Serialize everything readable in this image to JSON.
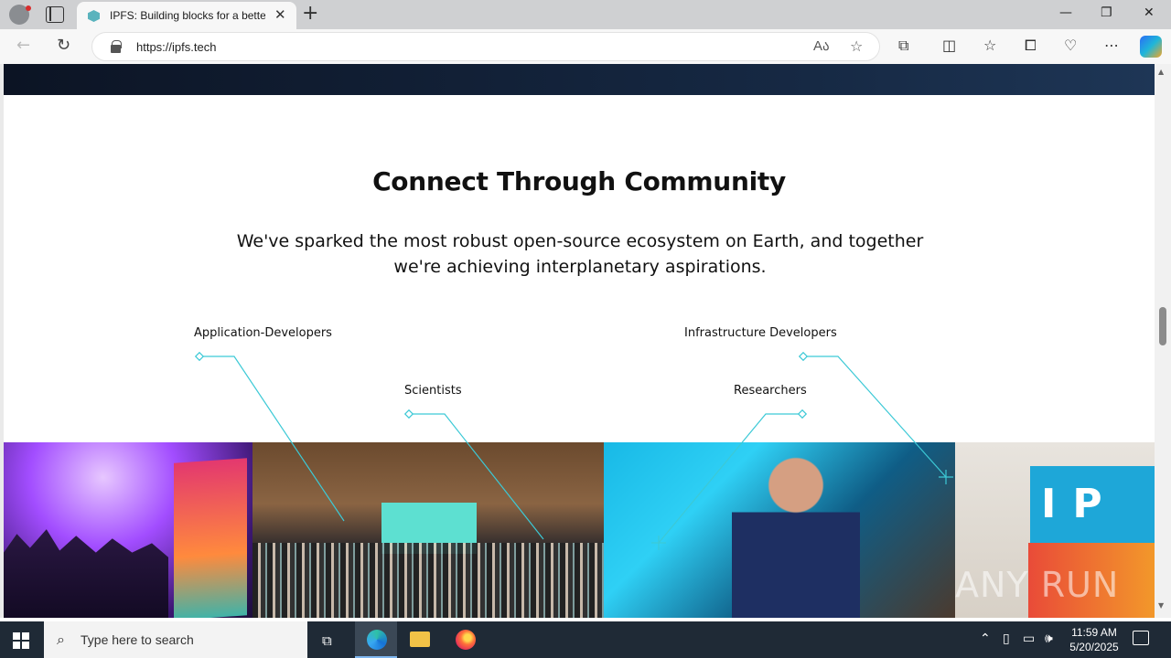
{
  "browser": {
    "tab_title": "IPFS: Building blocks for a better web",
    "url": "https://ipfs.tech",
    "new_tab_glyph": "+",
    "tab_close_glyph": "✕",
    "window_controls": {
      "minimize": "—",
      "maximize": "❐",
      "close": "✕"
    }
  },
  "page": {
    "heading": "Connect Through Community",
    "subtext": "We've sparked the most robust open-source ecosystem on Earth, and together we're achieving interplanetary aspirations.",
    "labels": {
      "app_devs": "Application-Developers",
      "scientists": "Scientists",
      "infra_devs": "Infrastructure Developers",
      "researchers": "Researchers"
    },
    "cube_letters": "IP",
    "connector_color": "#3cc9d6",
    "hero_color": "#0c1424"
  },
  "watermark": "ANY RUN",
  "taskbar": {
    "search_placeholder": "Type here to search",
    "time": "11:59 AM",
    "date": "5/20/2025"
  }
}
